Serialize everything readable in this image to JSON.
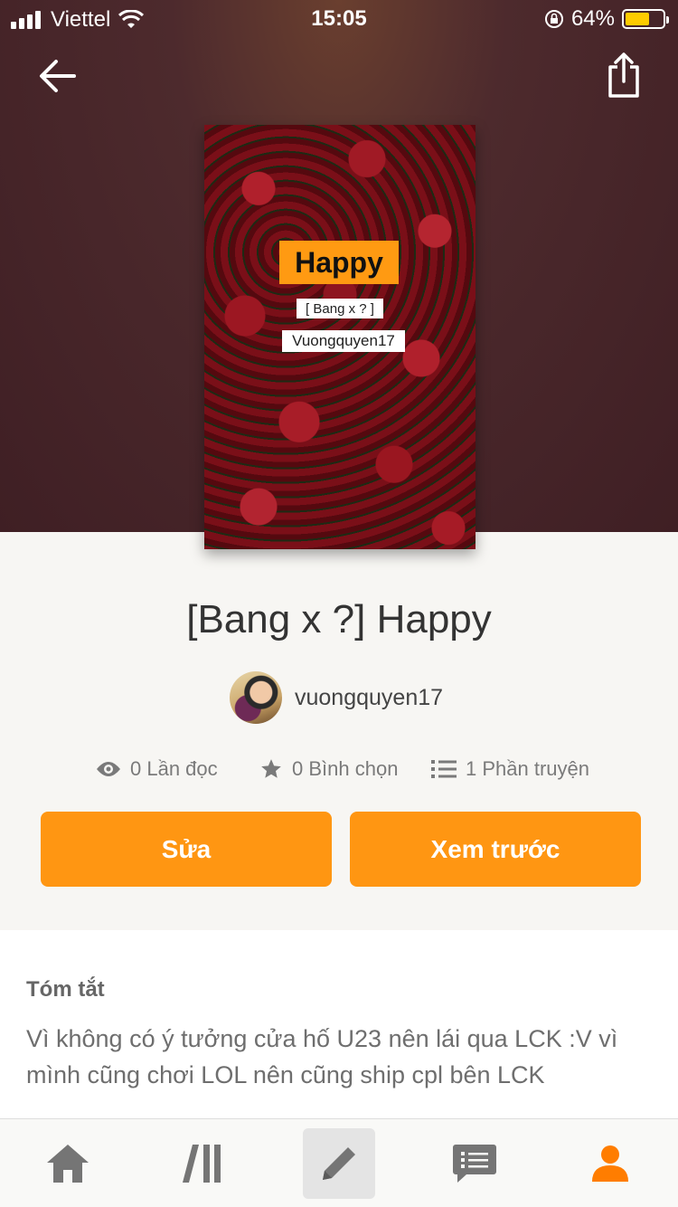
{
  "status_bar": {
    "carrier": "Viettel",
    "time": "15:05",
    "battery_percent": "64%",
    "battery_level": 0.64
  },
  "cover": {
    "title": "Happy",
    "subtitle": "[ Bang x ? ]",
    "author": "Vuongquyen17"
  },
  "story": {
    "title": "[Bang x ?] Happy",
    "author": "vuongquyen17"
  },
  "stats": {
    "reads": "0 Lần đọc",
    "votes": "0 Bình chọn",
    "parts": "1 Phần truyện"
  },
  "actions": {
    "edit_label": "Sửa",
    "preview_label": "Xem trước"
  },
  "summary": {
    "heading": "Tóm tắt",
    "text": "Vì không có ý tưởng cửa hố U23 nên lái qua LCK :V vì mình cũng chơi LOL nên cũng ship cpl bên LCK"
  },
  "tabs": [
    {
      "icon": "home-icon"
    },
    {
      "icon": "library-icon"
    },
    {
      "icon": "pencil-icon",
      "active": true
    },
    {
      "icon": "messages-icon"
    },
    {
      "icon": "profile-icon"
    }
  ],
  "colors": {
    "accent": "#ff9612",
    "profile_tab": "#ff7d00"
  }
}
